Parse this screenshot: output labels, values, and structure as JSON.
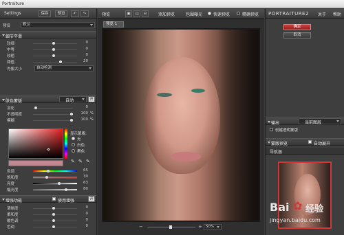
{
  "window": {
    "title": "Portraiture"
  },
  "left": {
    "toolbar": {
      "settings": "Settings",
      "save": "保存",
      "preset": "预设"
    },
    "preset": {
      "label": "预设",
      "value": "默认"
    },
    "detail": {
      "title": "细节平滑",
      "rows": [
        {
          "label": "较细",
          "value": "0"
        },
        {
          "label": "中等",
          "value": "0"
        },
        {
          "label": "较粗",
          "value": "0"
        },
        {
          "label": "阈值",
          "value": "20"
        }
      ],
      "size_label": "肖像大小",
      "size_value": "自动检测"
    },
    "mask": {
      "title": "肤色蒙版",
      "mode": "自动",
      "btn": "开",
      "rows": [
        {
          "label": "羽化",
          "value": "0",
          "pct": ""
        },
        {
          "label": "不透明度",
          "value": "100",
          "pct": "%"
        },
        {
          "label": "模糊",
          "value": "100",
          "pct": "%"
        }
      ],
      "display_label": "显示蒙版:",
      "options": [
        "无",
        "白色",
        "黑色"
      ],
      "color_rows": [
        {
          "label": "色调",
          "value": "65"
        },
        {
          "label": "饱和度",
          "value": "30"
        },
        {
          "label": "亮度",
          "value": "63"
        },
        {
          "label": "幅光度",
          "value": "80"
        }
      ]
    },
    "enhance": {
      "title": "增强功能",
      "use_label": "使用增强",
      "btn": "开",
      "rows": [
        {
          "label": "清晰度",
          "value": "0"
        },
        {
          "label": "柔和度",
          "value": "0"
        },
        {
          "label": "暖色调",
          "value": "0"
        },
        {
          "label": "色调",
          "value": "0"
        }
      ]
    }
  },
  "center": {
    "toolbar": {
      "preview": "预览",
      "add_preview": "添加预览",
      "bypass": "包围曝光",
      "quick_preview": "快速预览",
      "fine_preview": "精确预览"
    },
    "tab": "预览 1",
    "zoom": "50%"
  },
  "right": {
    "logo": "PORTRAITURE",
    "logo_num": "2",
    "about": "关于",
    "help": "帮助",
    "ok": "确定",
    "cancel": "取消",
    "output": {
      "title": "输出",
      "value": "当前图层",
      "create": "创建透明蒙版"
    },
    "auto": {
      "title": "蒙版预览",
      "auto": "自动展开"
    },
    "navigator": "导航器"
  },
  "watermark": {
    "logo": "Bai",
    "logo2": "经验",
    "url": "jingyan.baidu.com"
  },
  "colors": {
    "accent": "#d03838"
  }
}
